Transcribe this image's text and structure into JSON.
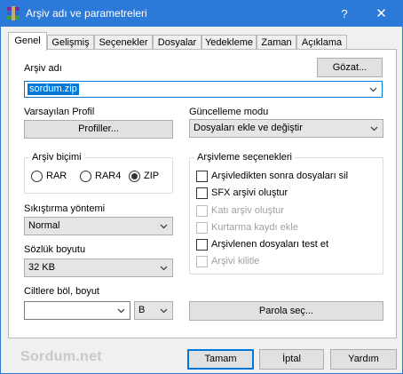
{
  "window": {
    "title": "Arşiv adı ve parametreleri",
    "help_glyph": "?",
    "close_glyph": "✕"
  },
  "tabs": [
    {
      "label": "Genel",
      "active": true
    },
    {
      "label": "Gelişmiş"
    },
    {
      "label": "Seçenekler"
    },
    {
      "label": "Dosyalar"
    },
    {
      "label": "Yedekleme"
    },
    {
      "label": "Zaman"
    },
    {
      "label": "Açıklama"
    }
  ],
  "archive_name": {
    "label": "Arşiv adı",
    "browse_button": "Gözat...",
    "value": "sordum.zip"
  },
  "default_profile": {
    "label": "Varsayılan Profil",
    "button": "Profiller..."
  },
  "update_mode": {
    "label": "Güncelleme modu",
    "value": "Dosyaları ekle ve değiştir"
  },
  "archive_format": {
    "title": "Arşiv biçimi",
    "options": [
      "RAR",
      "RAR4",
      "ZIP"
    ],
    "selected": "ZIP"
  },
  "compression_method": {
    "label": "Sıkıştırma yöntemi",
    "value": "Normal"
  },
  "dictionary_size": {
    "label": "Sözlük boyutu",
    "value": "32 KB"
  },
  "split_volumes": {
    "label": "Ciltlere böl, boyut",
    "value": "",
    "unit": "B"
  },
  "archiving_options": {
    "title": "Arşivleme seçenekleri",
    "items": [
      {
        "label": "Arşivledikten sonra dosyaları sil",
        "enabled": true,
        "checked": false
      },
      {
        "label": "SFX arşivi oluştur",
        "enabled": true,
        "checked": false
      },
      {
        "label": "Katı arşiv oluştur",
        "enabled": false,
        "checked": false
      },
      {
        "label": "Kurtarma kaydı ekle",
        "enabled": false,
        "checked": false
      },
      {
        "label": "Arşivlenen dosyaları test et",
        "enabled": true,
        "checked": false
      },
      {
        "label": "Arşivi kilitle",
        "enabled": false,
        "checked": false
      }
    ]
  },
  "password_button": "Parola seç...",
  "watermark": "Sordum.net",
  "buttons": {
    "ok": "Tamam",
    "cancel": "İptal",
    "help": "Yardım"
  },
  "colors": {
    "titlebar": "#2b79d8",
    "selection": "#0078d7"
  }
}
